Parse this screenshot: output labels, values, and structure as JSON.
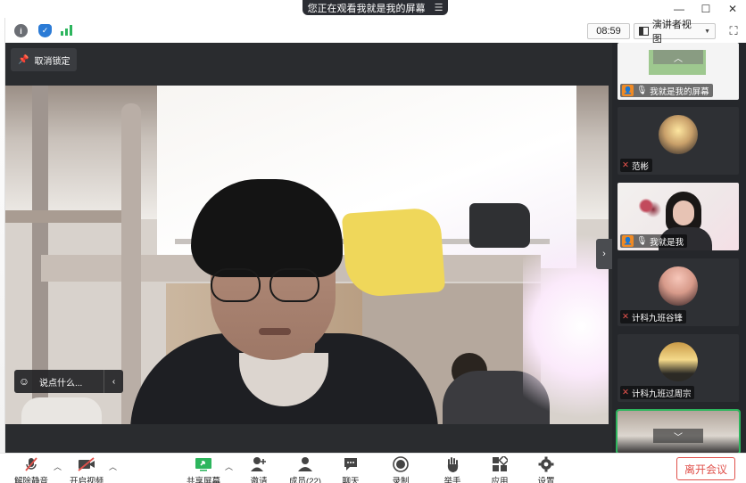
{
  "banner": {
    "text": "您正在观看我就是我的屏幕",
    "menu_icon": "list-icon"
  },
  "top_bar": {
    "timer": "08:59",
    "view_label": "演讲者视图"
  },
  "stage": {
    "unpin_label": "取消锁定",
    "chat_placeholder": "说点什么..."
  },
  "gallery": {
    "tiles": [
      {
        "name": "我就是我的屏幕",
        "host": true,
        "muted": false,
        "type": "screen"
      },
      {
        "name": "范彬",
        "host": false,
        "muted": true,
        "type": "avatar"
      },
      {
        "name": "我就是我",
        "host": true,
        "muted": false,
        "type": "camera"
      },
      {
        "name": "计科九班谷锋",
        "host": false,
        "muted": true,
        "type": "avatar"
      },
      {
        "name": "计科九班过周宗",
        "host": false,
        "muted": true,
        "type": "avatar"
      },
      {
        "name": "",
        "host": false,
        "muted": false,
        "type": "camera-active"
      }
    ]
  },
  "toolbar": {
    "unmute": "解除静音",
    "start_video": "开启视频",
    "share_screen": "共享屏幕",
    "invite": "邀请",
    "members": "成员(22)",
    "chat": "聊天",
    "record": "录制",
    "raise_hand": "举手",
    "apps": "应用",
    "settings": "设置",
    "leave": "离开会议"
  },
  "colors": {
    "accent_green": "#2db55d",
    "leave_red": "#e0514b",
    "host_orange": "#f08a24",
    "stage_bg": "#2a2c2f"
  }
}
